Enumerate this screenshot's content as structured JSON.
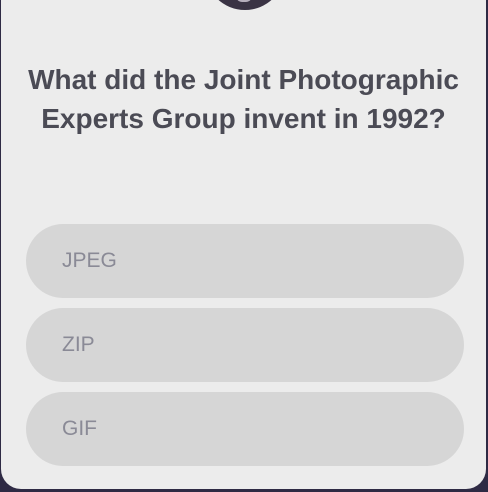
{
  "quiz": {
    "question": "What did the Joint Photographic Experts Group invent in 1992?",
    "options": [
      {
        "label": "JPEG"
      },
      {
        "label": "ZIP"
      },
      {
        "label": "GIF"
      }
    ]
  }
}
